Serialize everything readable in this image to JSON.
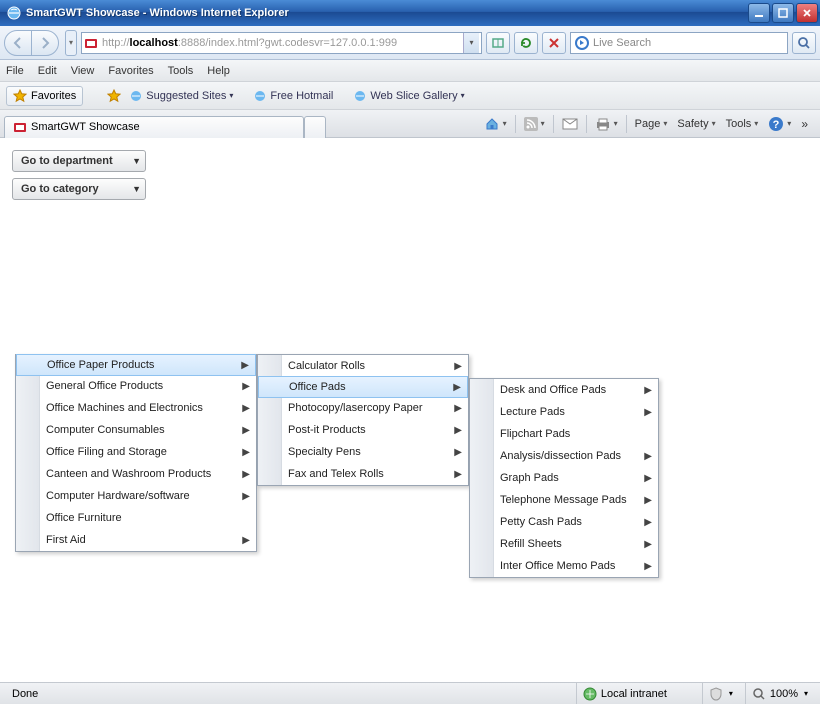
{
  "window": {
    "title": "SmartGWT Showcase - Windows Internet Explorer"
  },
  "address": {
    "protocol": "http://",
    "host": "localhost",
    "rest": ":8888/index.html?gwt.codesvr=127.0.0.1:999"
  },
  "search": {
    "placeholder": "Live Search"
  },
  "menus": {
    "file": "File",
    "edit": "Edit",
    "view": "View",
    "favorites": "Favorites",
    "tools": "Tools",
    "help": "Help"
  },
  "favbar": {
    "favorites": "Favorites",
    "suggested": "Suggested Sites",
    "hotmail": "Free Hotmail",
    "webslice": "Web Slice Gallery"
  },
  "tab": {
    "title": "SmartGWT Showcase"
  },
  "cmdbar": {
    "page": "Page",
    "safety": "Safety",
    "tools": "Tools"
  },
  "dropdowns": {
    "department": "Go to department",
    "category": "Go to category"
  },
  "menu1": {
    "items": [
      "Office Paper Products",
      "General Office Products",
      "Office Machines and Electronics",
      "Computer Consumables",
      "Office Filing and Storage",
      "Canteen and Washroom Products",
      "Computer Hardware/software",
      "Office Furniture",
      "First Aid"
    ]
  },
  "menu2": {
    "items": [
      "Calculator Rolls",
      "Office Pads",
      "Photocopy/lasercopy Paper",
      "Post-it Products",
      "Specialty Pens",
      "Fax and Telex Rolls"
    ]
  },
  "menu3": {
    "items": [
      "Desk and Office Pads",
      "Lecture Pads",
      "Flipchart Pads",
      "Analysis/dissection Pads",
      "Graph Pads",
      "Telephone Message Pads",
      "Petty Cash Pads",
      "Refill Sheets",
      "Inter Office Memo Pads"
    ]
  },
  "status": {
    "done": "Done",
    "zone": "Local intranet",
    "zoom": "100%"
  }
}
